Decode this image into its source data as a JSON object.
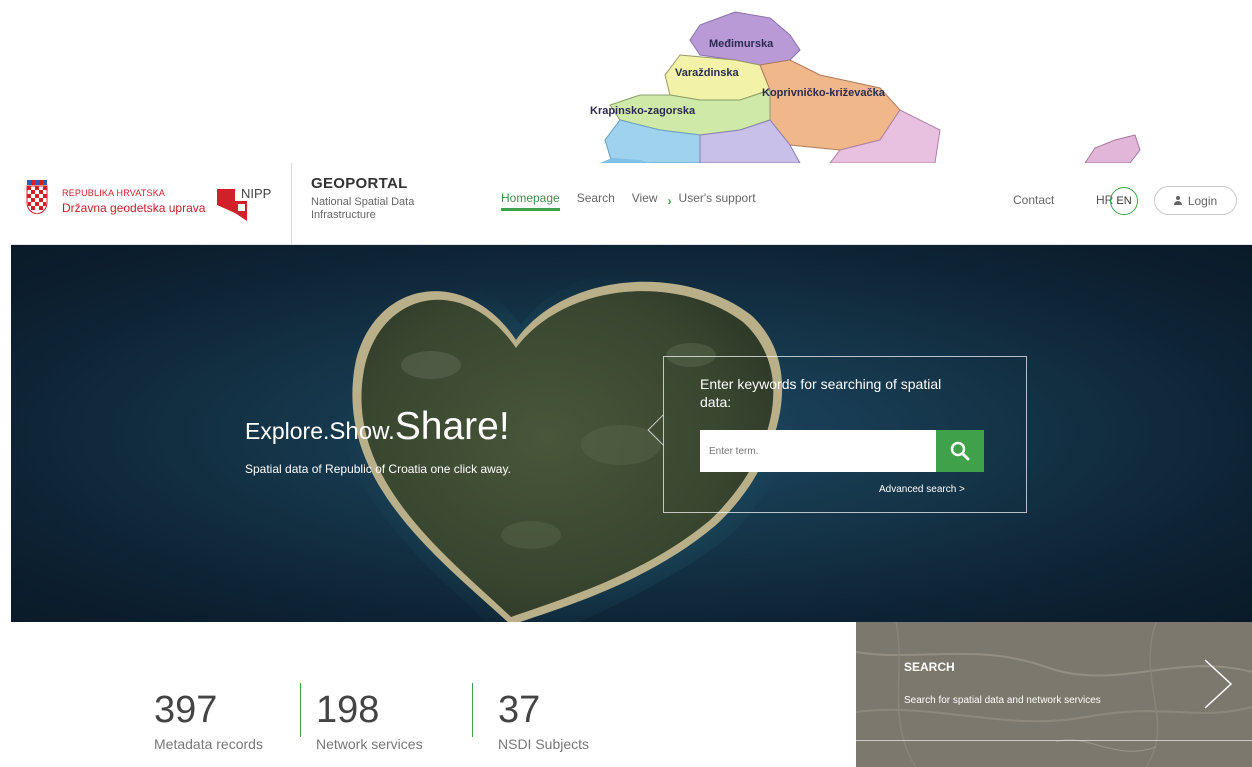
{
  "background_map": {
    "labels": [
      "Međimurska",
      "Varaždinska",
      "Koprivničko-križevačka",
      "Krapinsko-zagorska"
    ]
  },
  "header": {
    "republic_label": "REPUBLIKA HRVATSKA",
    "agency_label": "Državna geodetska uprava",
    "nipp_logo_text": "NIPP",
    "portal_title": "GEOPORTAL",
    "portal_subtitle": "National Spatial Data Infrastructure",
    "nav": [
      {
        "label": "Homepage",
        "active": true
      },
      {
        "label": "Search",
        "active": false
      },
      {
        "label": "View",
        "active": false
      },
      {
        "label": "User's support",
        "active": false,
        "icon": "chevron-right-icon"
      }
    ],
    "contact_label": "Contact",
    "lang_hr": "HR",
    "lang_en": "EN",
    "login_label": "Login"
  },
  "hero": {
    "tagline_part1": "Explore.",
    "tagline_part2": "Show.",
    "tagline_part3": "Share!",
    "subtitle": "Spatial data of Republic of Croatia one click away.",
    "search_prompt": "Enter keywords for searching of spatial data:",
    "search_placeholder": "Enter term.",
    "advanced_search": "Advanced search >"
  },
  "stats": [
    {
      "value": "397",
      "label": "Metadata records"
    },
    {
      "value": "198",
      "label": "Network services"
    },
    {
      "value": "37",
      "label": "NSDI Subjects"
    }
  ],
  "search_panel": {
    "title": "SEARCH",
    "description": "Search for spatial data and network services"
  },
  "colors": {
    "accent_green": "#3fa14a",
    "brand_red": "#d0202a",
    "hero_dark": "#0d2233"
  }
}
